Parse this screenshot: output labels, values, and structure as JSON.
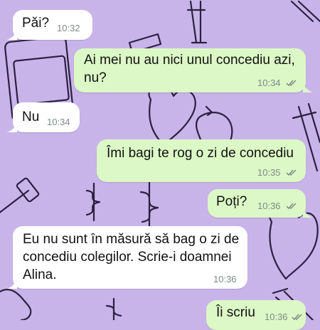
{
  "chat": {
    "messages": [
      {
        "direction": "incoming",
        "lines": [
          "Păi?"
        ],
        "time": "10:32"
      },
      {
        "direction": "outgoing",
        "lines": [
          "Ai mei nu au nici unul concediu azi,",
          "nu?"
        ],
        "time": "10:34",
        "status": "read"
      },
      {
        "direction": "incoming",
        "lines": [
          "Nu"
        ],
        "time": "10:34"
      },
      {
        "direction": "outgoing",
        "lines": [
          "Îmi bagi te rog o zi de concediu"
        ],
        "time": "10:35",
        "status": "read"
      },
      {
        "direction": "outgoing",
        "lines": [
          "Poți?"
        ],
        "time": "10:36",
        "status": "read"
      },
      {
        "direction": "incoming",
        "lines": [
          "Eu nu sunt în măsură să bag o zi de",
          "concediu colegilor. Scrie-i doamnei",
          "Alina."
        ],
        "time": "10:36"
      },
      {
        "direction": "outgoing",
        "lines": [
          "Îi scriu"
        ],
        "time": "10:36",
        "status": "read"
      }
    ]
  },
  "colors": {
    "wallpaper": "#c9b4ea",
    "incoming_bubble": "#ffffff",
    "outgoing_bubble": "#dcf8c6",
    "read_ticks": "#7e8a86"
  },
  "wallpaper_icons": [
    "crutch-icon",
    "heart-icon",
    "tooth-icon",
    "dumbbell-icon",
    "medkit-icon",
    "caduceus-icon",
    "bandage-icon",
    "stethoscope-icon"
  ]
}
